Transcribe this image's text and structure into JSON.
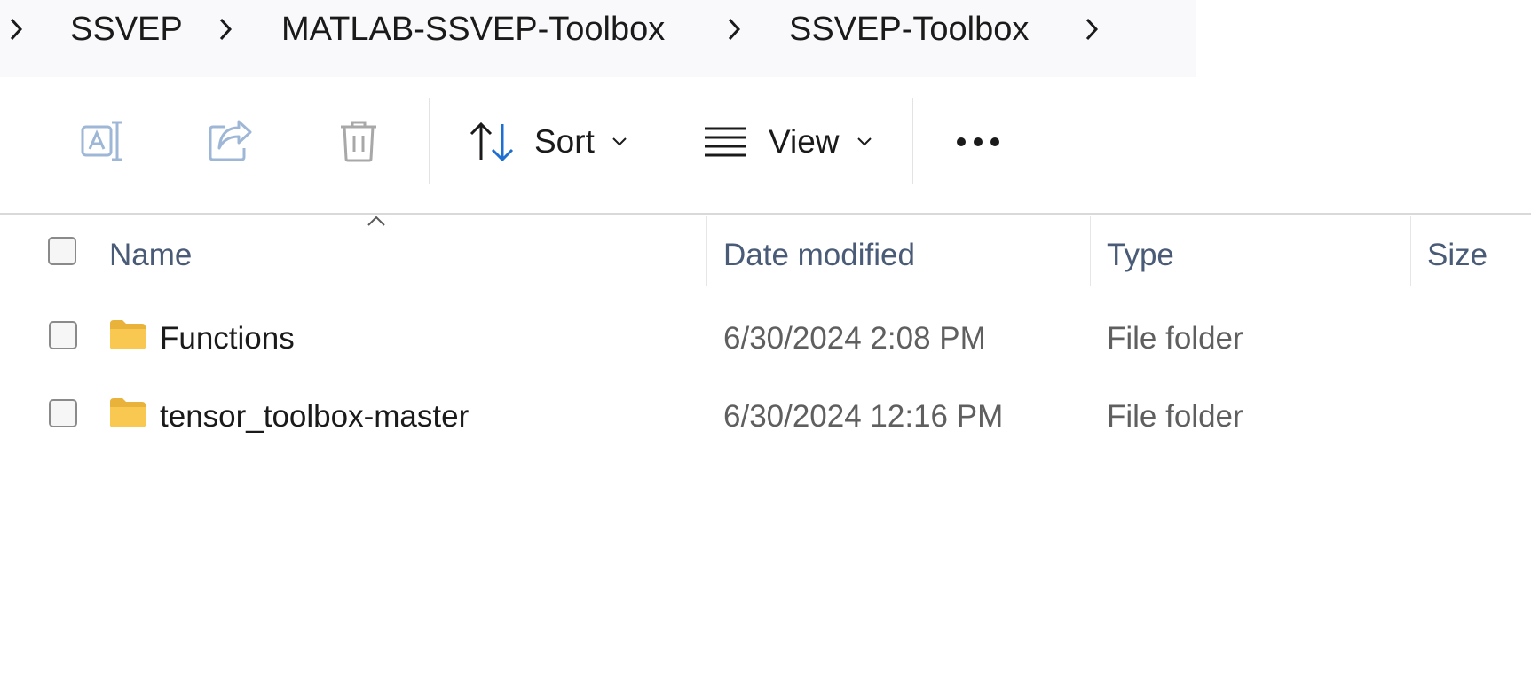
{
  "breadcrumb": {
    "items": [
      "SSVEP",
      "MATLAB-SSVEP-Toolbox",
      "SSVEP-Toolbox"
    ],
    "separator_icon": "chevron-right-icon"
  },
  "toolbar": {
    "buttons": [
      {
        "icon": "rename-icon",
        "enabled": false
      },
      {
        "icon": "share-icon",
        "enabled": false
      },
      {
        "icon": "delete-icon",
        "enabled": false
      }
    ],
    "sort_label": "Sort",
    "view_label": "View",
    "more_icon": "more-icon"
  },
  "columns": {
    "name": "Name",
    "date_modified": "Date modified",
    "type": "Type",
    "size": "Size",
    "sort_indicator": "chevron-up-icon"
  },
  "files": [
    {
      "name": "Functions",
      "date_modified": "6/30/2024 2:08 PM",
      "type": "File folder",
      "size": ""
    },
    {
      "name": "tensor_toolbox-master",
      "date_modified": "6/30/2024 12:16 PM",
      "type": "File folder",
      "size": ""
    }
  ],
  "colors": {
    "accent": "#1f6fd1",
    "disabled_icon": "#9fb7d6",
    "folder_yellow": "#f8c850",
    "header_text": "#4a5b77"
  }
}
